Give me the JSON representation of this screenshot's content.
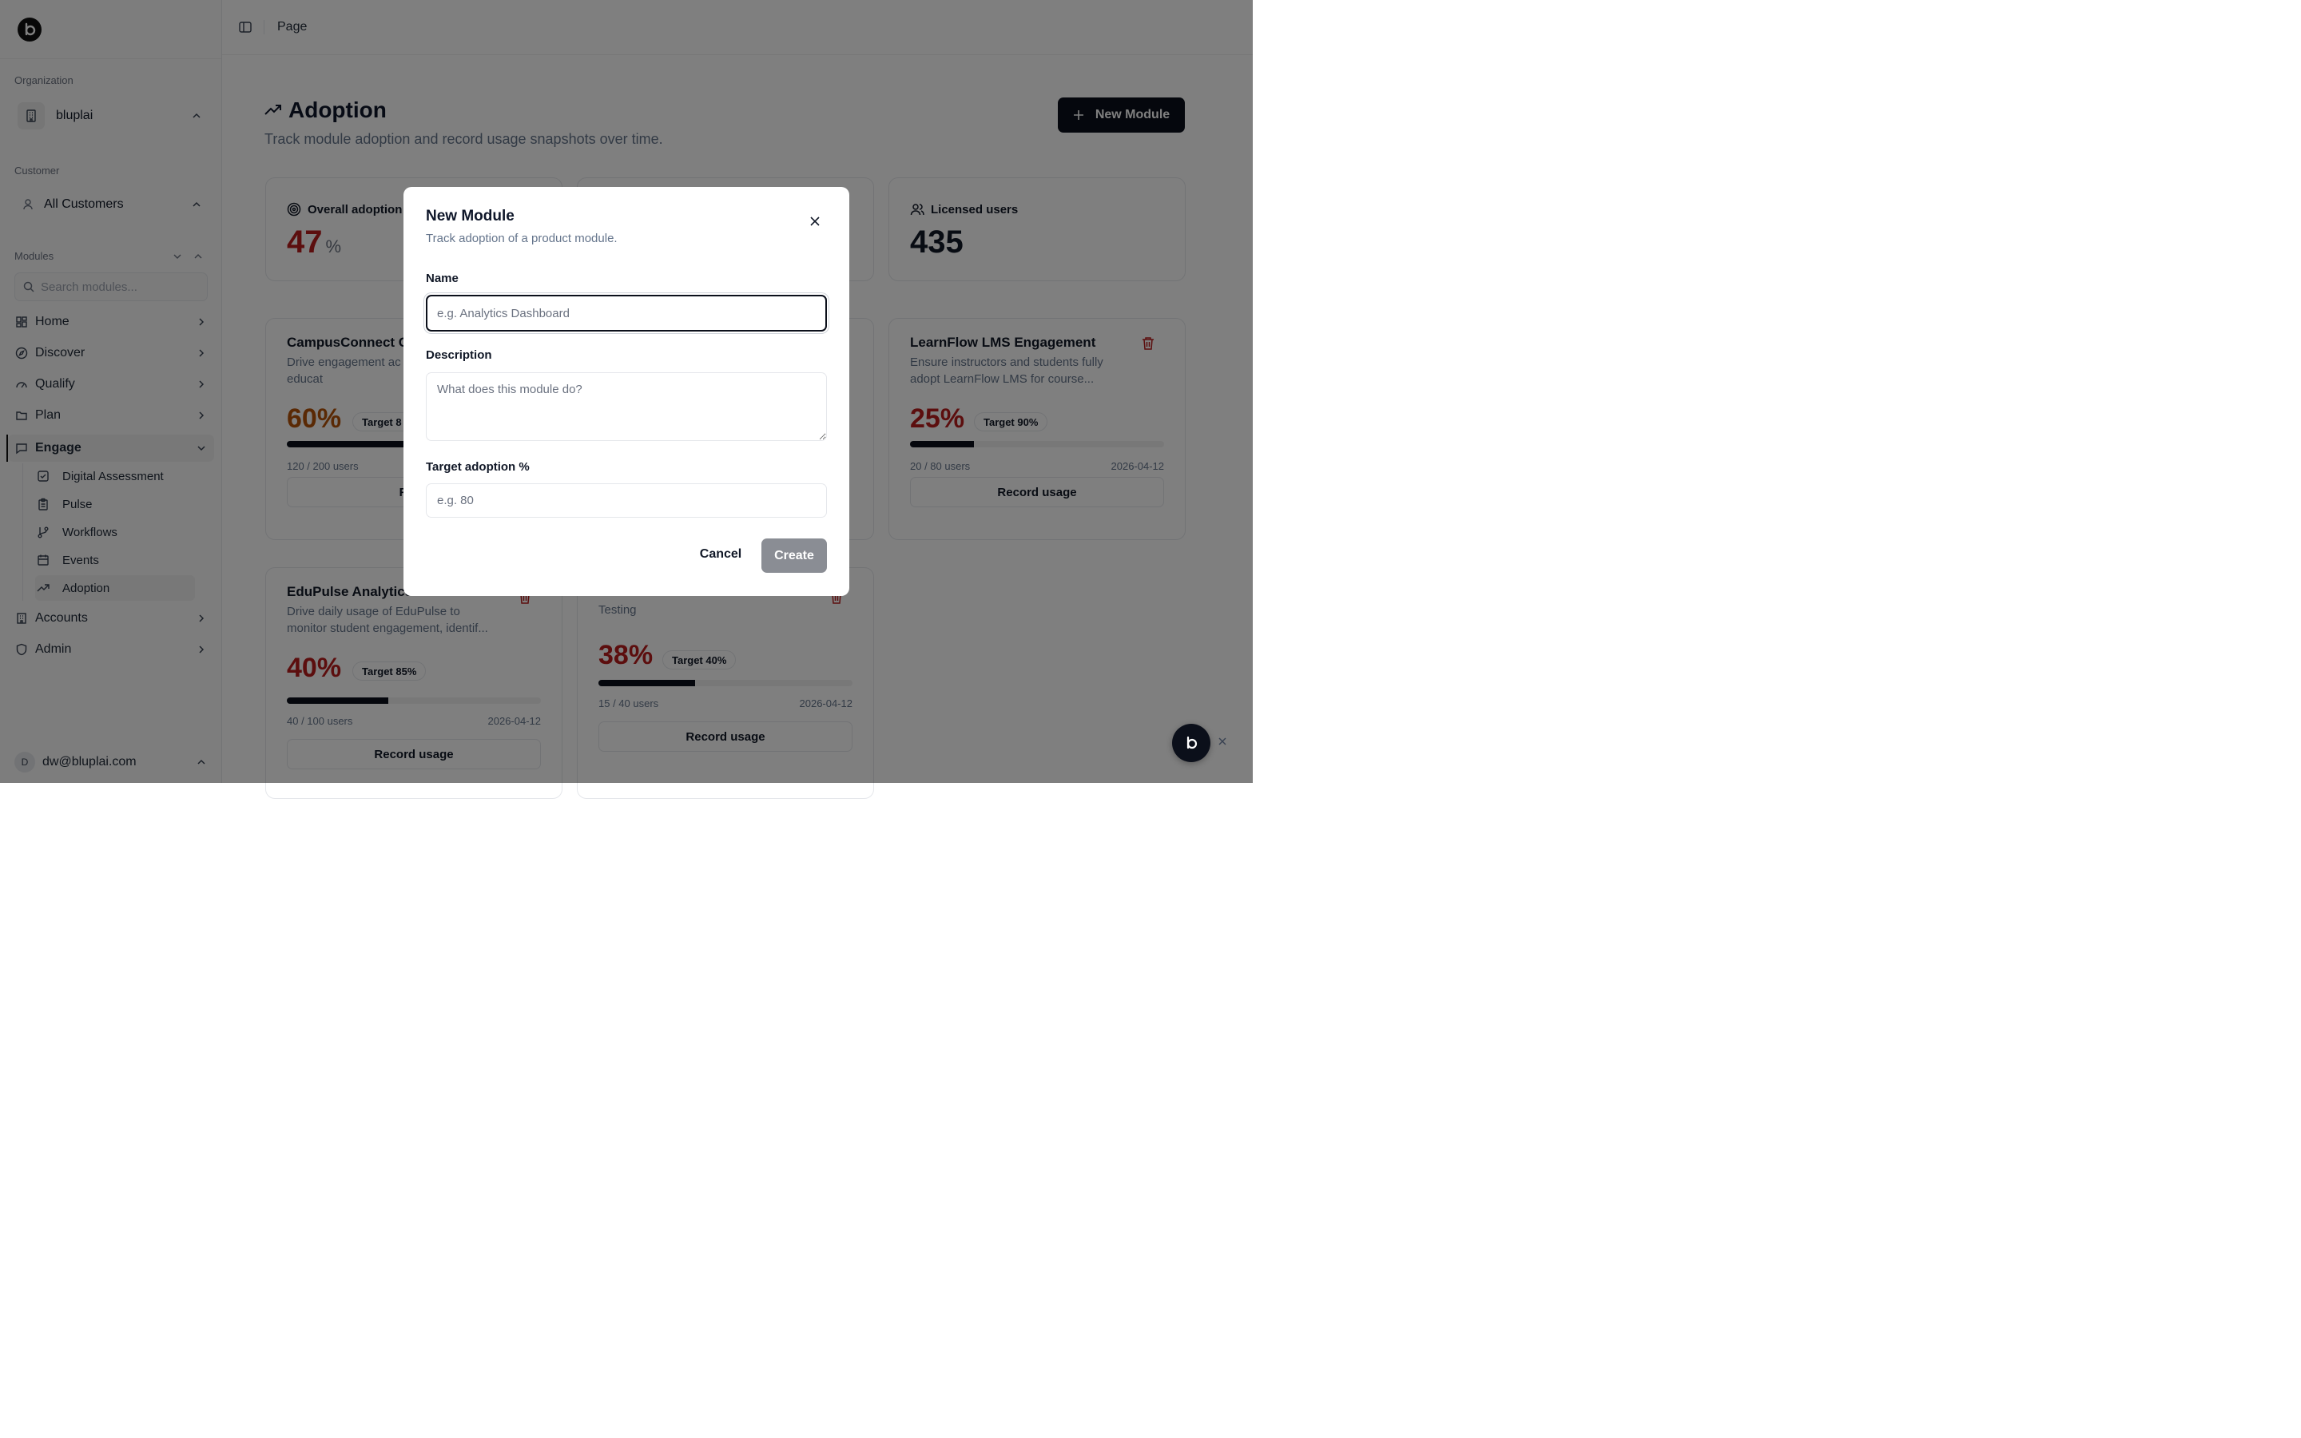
{
  "colors": {
    "accent": "#0b0f1a",
    "danger": "#b91c1c",
    "warning": "#b45309",
    "muted_text": "#64748b"
  },
  "sidebar": {
    "logo_icon": "brand-b-icon",
    "org_label": "Organization",
    "org_name": "bluplai",
    "customer_label": "Customer",
    "customer_name": "All Customers",
    "modules_label": "Modules",
    "search_placeholder": "Search modules...",
    "nav": [
      {
        "label": "Home",
        "icon": "home-grid-icon"
      },
      {
        "label": "Discover",
        "icon": "compass-icon"
      },
      {
        "label": "Qualify",
        "icon": "gauge-icon"
      },
      {
        "label": "Plan",
        "icon": "folder-icon"
      },
      {
        "label": "Engage",
        "icon": "message-square-icon"
      },
      {
        "label": "Accounts",
        "icon": "building-icon"
      },
      {
        "label": "Admin",
        "icon": "shield-icon"
      }
    ],
    "engage_sub": [
      {
        "label": "Digital Assessment",
        "icon": "checkbox-icon"
      },
      {
        "label": "Pulse",
        "icon": "clipboard-icon"
      },
      {
        "label": "Workflows",
        "icon": "git-branch-icon"
      },
      {
        "label": "Events",
        "icon": "calendar-icon"
      },
      {
        "label": "Adoption",
        "icon": "trending-up-icon"
      }
    ],
    "user_initial": "D",
    "user_email": "dw@bluplai.com"
  },
  "topbar": {
    "breadcrumb": "Page"
  },
  "main": {
    "title": "Adoption",
    "subtitle": "Track module adoption and record usage snapshots over time.",
    "new_button": "New Module",
    "stats": [
      {
        "label": "Overall adoption",
        "value": "47",
        "unit": "%"
      },
      {
        "label": "Licensed users",
        "value": "435"
      }
    ],
    "modules": [
      {
        "name": "CampusConnect C",
        "desc": "Drive engagement ac students, and educat",
        "pct": "60%",
        "pct_value": 60,
        "target": "Target 8",
        "users": "120 / 200 users",
        "date": "",
        "record": "Reco"
      },
      {
        "name": "LearnFlow LMS Engagement",
        "desc": "Ensure instructors and students fully adopt LearnFlow LMS for course...",
        "pct": "25%",
        "pct_value": 25,
        "target": "Target 90%",
        "users": "20 / 80 users",
        "date": "2026-04-12",
        "record": "Record usage"
      },
      {
        "name": "EduPulse Analytics",
        "desc": "Drive daily usage of EduPulse to monitor student engagement, identif...",
        "pct": "40%",
        "pct_value": 40,
        "target": "Target 85%",
        "users": "40 / 100 users",
        "date": "2026-04-12",
        "record": "Record usage"
      },
      {
        "name": "",
        "desc": "Testing",
        "pct": "38%",
        "pct_value": 38,
        "target": "Target 40%",
        "users": "15 / 40 users",
        "date": "2026-04-12",
        "record": "Record usage"
      }
    ]
  },
  "modal": {
    "title": "New Module",
    "subtitle": "Track adoption of a product module.",
    "name_label": "Name",
    "name_placeholder": "e.g. Analytics Dashboard",
    "desc_label": "Description",
    "desc_placeholder": "What does this module do?",
    "target_label": "Target adoption %",
    "target_placeholder": "e.g. 80",
    "cancel": "Cancel",
    "create": "Create"
  }
}
